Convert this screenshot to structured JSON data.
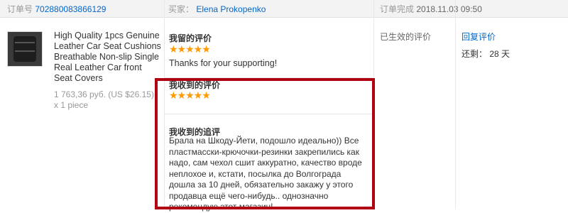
{
  "order": {
    "number_label": "订单号",
    "number": "702880083866129",
    "buyer_label": "买家：",
    "buyer": "Elena Prokopenko",
    "completed_label": "订单完成",
    "completed_time": "2018.11.03 09:50"
  },
  "product": {
    "title": "High Quality 1pcs Genuine Leather Car Seat Cushions Breathable Non-slip Single Real Leather Car front Seat Covers",
    "price": "1 763,36 руб. (US $26.15)",
    "quantity": "x 1 piece"
  },
  "my_review": {
    "title": "我留的评价",
    "rating": 5,
    "stars": "★★★★★",
    "text": "Thanks for your supporting!"
  },
  "received_review": {
    "title": "我收到的评价",
    "rating": 5,
    "stars": "★★★★★"
  },
  "followup": {
    "title": "我收到的追评",
    "text": "Брала на Шкоду-Йети, подошло идеально)) Все пластмасски-крючочки-резинки закрепились как надо, сам чехол сшит аккуратно, качество вроде неплохое и, кстати, посылка до Волгограда дошла за 10 дней, обязательно закажу у этого продавца ещё чего-нибудь.. однозначно рекомендую этот магазин!"
  },
  "status": {
    "text": "已生效的评价"
  },
  "actions": {
    "reply_label": "回复评价",
    "remaining_label": "还剩：",
    "remaining_value": "28 天"
  },
  "colors": {
    "accent": "#0066cc",
    "star": "#ff9a00",
    "highlight_border": "#b00012"
  }
}
